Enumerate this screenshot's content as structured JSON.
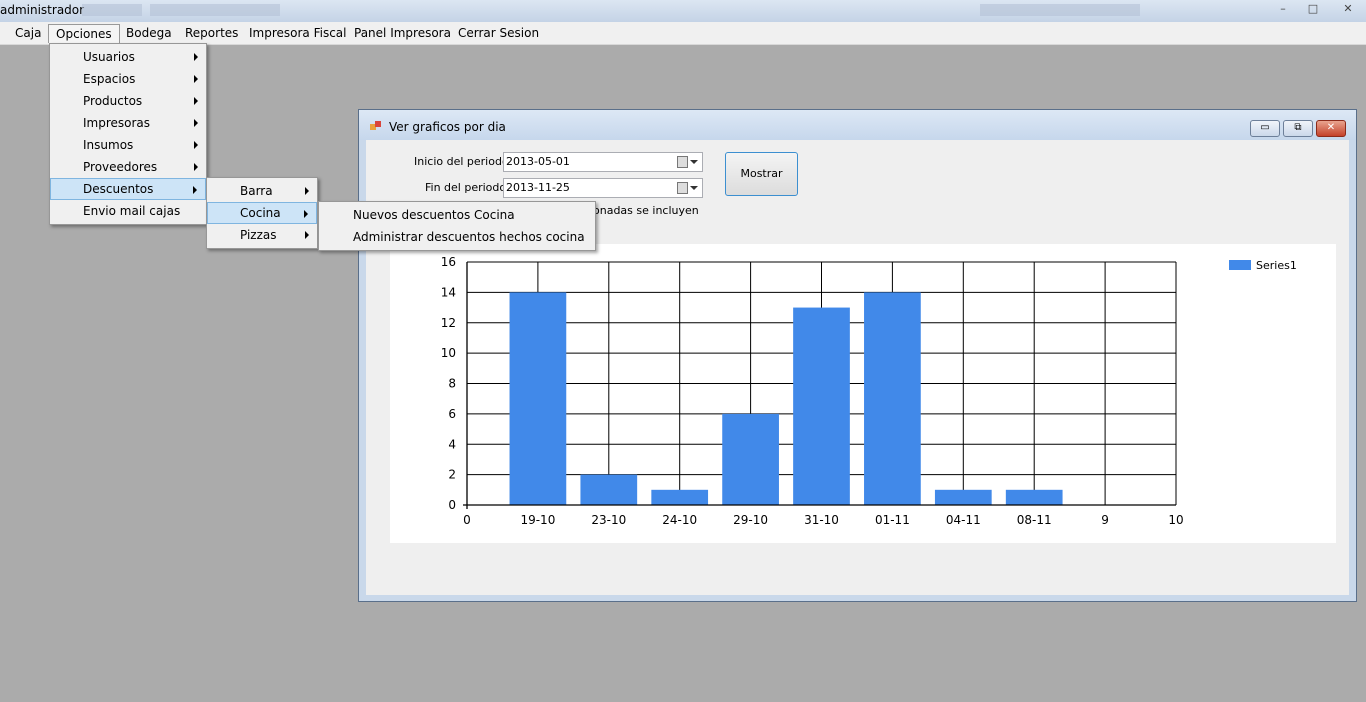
{
  "window": {
    "title": "administrador"
  },
  "menubar": {
    "items": [
      {
        "label": "Caja"
      },
      {
        "label": "Opciones"
      },
      {
        "label": "Bodega"
      },
      {
        "label": "Reportes"
      },
      {
        "label": "Impresora Fiscal"
      },
      {
        "label": "Panel Impresora"
      },
      {
        "label": "Cerrar Sesion"
      }
    ]
  },
  "opciones_menu": {
    "items": [
      "Usuarios",
      "Espacios",
      "Productos",
      "Impresoras",
      "Insumos",
      "Proveedores",
      "Descuentos",
      "Envio mail cajas"
    ]
  },
  "descuentos_menu": {
    "items": [
      "Barra",
      "Cocina",
      "Pizzas"
    ]
  },
  "cocina_menu": {
    "items": [
      "Nuevos descuentos Cocina",
      "Administrar descuentos hechos cocina"
    ]
  },
  "dialog": {
    "title": "Ver graficos por dia",
    "inicio_label": "Inicio del periodo :",
    "inicio_value": "2013-05-01",
    "fin_label": "Fin del periodo :",
    "fin_value": "2013-11-25",
    "note_fragment": "onadas se incluyen",
    "button": "Mostrar"
  },
  "colors": {
    "bar": "#4189e9",
    "accent": "#3c8fd0"
  },
  "chart_data": {
    "type": "bar",
    "x_ticks": [
      "0",
      "19-10",
      "23-10",
      "24-10",
      "29-10",
      "31-10",
      "01-11",
      "04-11",
      "08-11",
      "9",
      "10"
    ],
    "categories": [
      "19-10",
      "23-10",
      "24-10",
      "29-10",
      "31-10",
      "01-11",
      "04-11",
      "08-11"
    ],
    "series": [
      {
        "name": "Series1",
        "values": [
          14,
          2,
          1,
          6,
          13,
          14,
          1,
          1
        ]
      }
    ],
    "ylim": [
      0,
      16
    ],
    "y_ticks": [
      0,
      2,
      4,
      6,
      8,
      10,
      12,
      14,
      16
    ],
    "grid": true,
    "legend": "top-right"
  }
}
